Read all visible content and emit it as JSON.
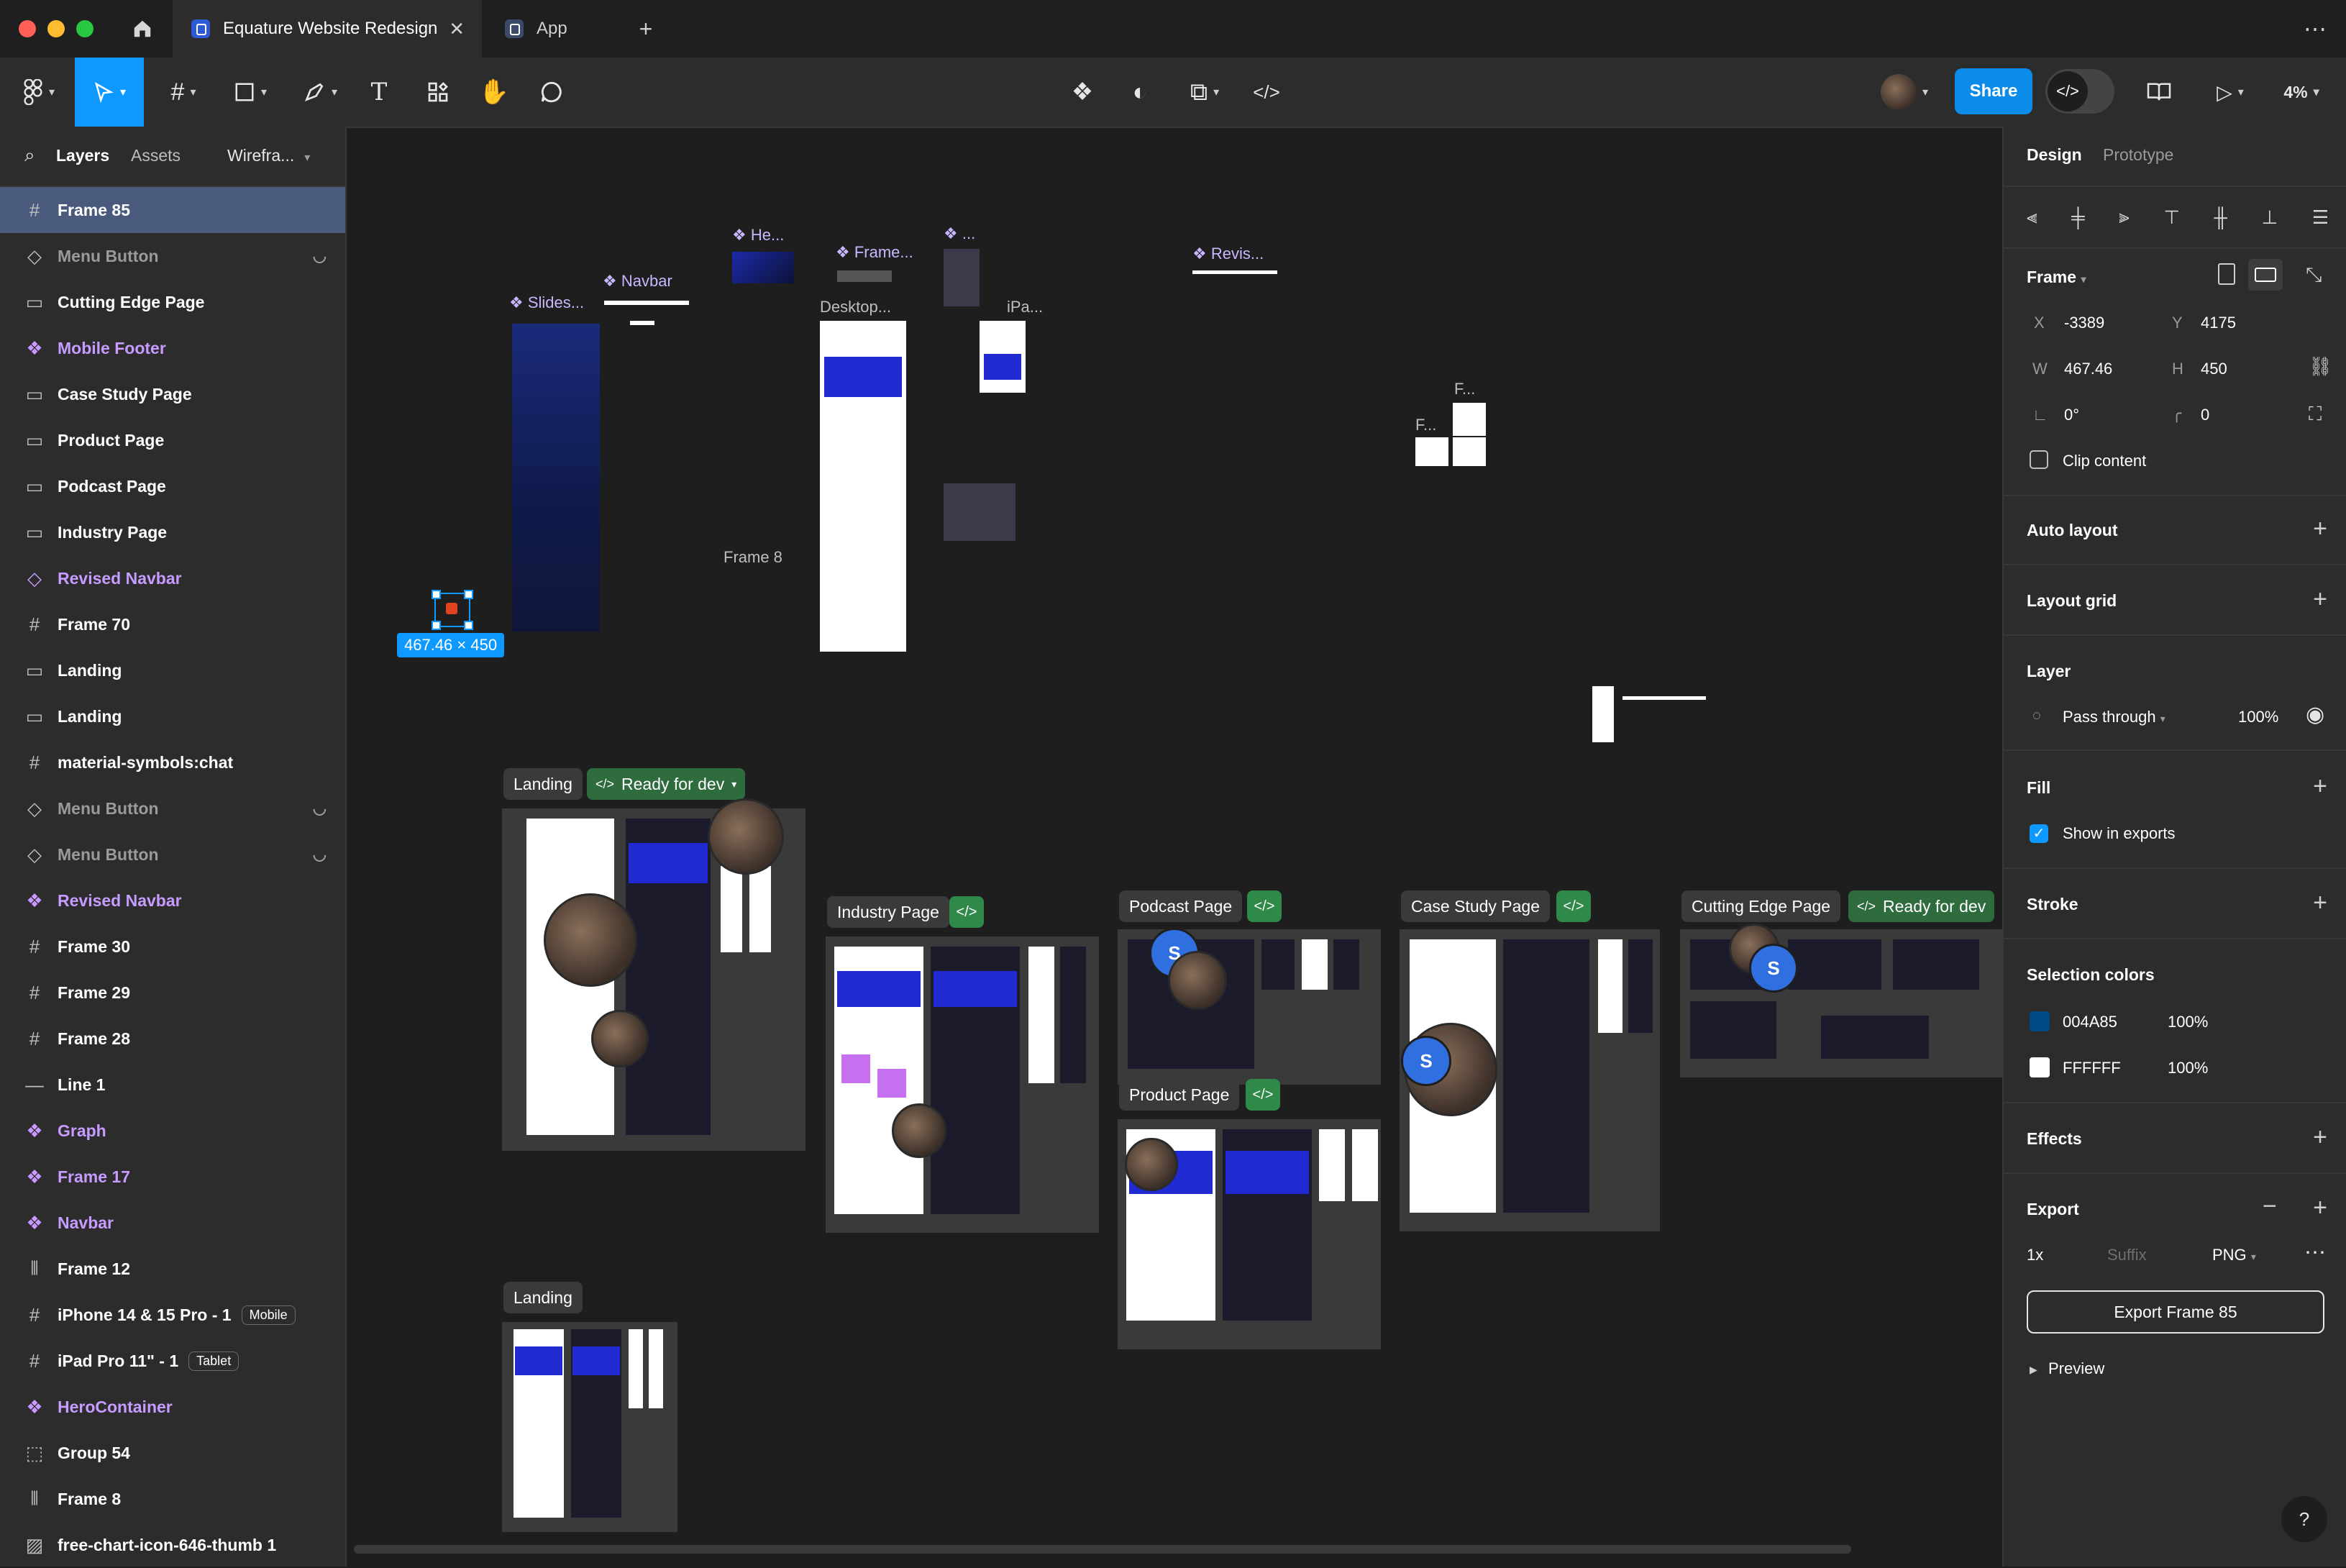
{
  "titlebar": {
    "tabs": [
      {
        "label": "Equature Website Redesign",
        "active": true
      },
      {
        "label": "App",
        "active": false
      }
    ],
    "new_tab_icon": "plus-icon",
    "more_icon": "more-icon"
  },
  "toolbar": {
    "share_label": "Share",
    "zoom_label": "4%"
  },
  "left_panel": {
    "tabs": [
      "Layers",
      "Assets"
    ],
    "page_selector": "Wirefra...",
    "layers": [
      {
        "name": "Frame 85",
        "icon": "frame-icon",
        "style": "selected"
      },
      {
        "name": "Menu Button",
        "icon": "instance-icon",
        "style": "dim",
        "hidden": true
      },
      {
        "name": "Cutting Edge Page",
        "icon": "section-icon",
        "style": "normal"
      },
      {
        "name": "Mobile Footer",
        "icon": "component-icon",
        "style": "purple"
      },
      {
        "name": "Case Study Page",
        "icon": "section-icon",
        "style": "normal"
      },
      {
        "name": "Product Page",
        "icon": "section-icon",
        "style": "normal"
      },
      {
        "name": "Podcast Page",
        "icon": "section-icon",
        "style": "normal"
      },
      {
        "name": "Industry Page",
        "icon": "section-icon",
        "style": "normal"
      },
      {
        "name": "Revised Navbar",
        "icon": "instance-icon",
        "style": "purple"
      },
      {
        "name": "Frame 70",
        "icon": "frame-icon",
        "style": "normal"
      },
      {
        "name": "Landing",
        "icon": "section-icon",
        "style": "normal"
      },
      {
        "name": "Landing",
        "icon": "section-icon",
        "style": "normal"
      },
      {
        "name": "material-symbols:chat",
        "icon": "frame-icon",
        "style": "normal"
      },
      {
        "name": "Menu Button",
        "icon": "instance-icon",
        "style": "dim",
        "hidden": true
      },
      {
        "name": "Menu Button",
        "icon": "instance-icon",
        "style": "dim",
        "hidden": true
      },
      {
        "name": "Revised Navbar",
        "icon": "component-icon",
        "style": "purple"
      },
      {
        "name": "Frame 30",
        "icon": "frame-icon",
        "style": "normal"
      },
      {
        "name": "Frame 29",
        "icon": "frame-icon",
        "style": "normal"
      },
      {
        "name": "Frame 28",
        "icon": "frame-icon",
        "style": "normal"
      },
      {
        "name": "Line 1",
        "icon": "line-icon",
        "style": "normal"
      },
      {
        "name": "Graph",
        "icon": "component-icon",
        "style": "purple"
      },
      {
        "name": "Frame 17",
        "icon": "component-icon",
        "style": "purple"
      },
      {
        "name": "Navbar",
        "icon": "component-icon",
        "style": "purple"
      },
      {
        "name": "Frame 12",
        "icon": "columns-icon",
        "style": "normal"
      },
      {
        "name": "iPhone 14 & 15 Pro - 1",
        "icon": "frame-icon",
        "style": "normal",
        "badge": "Mobile"
      },
      {
        "name": "iPad Pro 11\" - 1",
        "icon": "frame-icon",
        "style": "normal",
        "badge": "Tablet"
      },
      {
        "name": "HeroContainer",
        "icon": "component-icon",
        "style": "purple"
      },
      {
        "name": "Group 54",
        "icon": "group-icon",
        "style": "normal"
      },
      {
        "name": "Frame 8",
        "icon": "columns-icon",
        "style": "normal"
      },
      {
        "name": "free-chart-icon-646-thumb 1",
        "icon": "image-icon",
        "style": "normal"
      }
    ]
  },
  "canvas": {
    "selection_size": "467.46 × 450",
    "labels": {
      "slides": "Slides...",
      "navbar": "Navbar",
      "hero": "He...",
      "frame_comp": "Frame...",
      "dots": "...",
      "revis": "Revis...",
      "desktop": "Desktop...",
      "ipad": "iPa...",
      "frame8": "Frame 8",
      "f1": "F...",
      "f2": "F..."
    },
    "sections": {
      "landing": "Landing",
      "landing_ready": "Ready for dev",
      "industry": "Industry Page",
      "podcast": "Podcast Page",
      "case_study": "Case Study Page",
      "cutting_edge": "Cutting Edge Page",
      "cutting_ready": "Ready for dev",
      "product": "Product Page",
      "landing2": "Landing"
    },
    "code_icon": "</>",
    "user_initial": "S"
  },
  "right_panel": {
    "tabs": [
      "Design",
      "Prototype"
    ],
    "frame_label": "Frame",
    "x_label": "X",
    "x_value": "-3389",
    "y_label": "Y",
    "y_value": "4175",
    "w_label": "W",
    "w_value": "467.46",
    "h_label": "H",
    "h_value": "450",
    "rotation": "0°",
    "radius": "0",
    "clip_content": "Clip content",
    "auto_layout": "Auto layout",
    "layout_grid": "Layout grid",
    "layer": "Layer",
    "blend_mode": "Pass through",
    "layer_opacity": "100%",
    "fill": "Fill",
    "show_in_exports": "Show in exports",
    "stroke": "Stroke",
    "selection_colors": "Selection colors",
    "colors": [
      {
        "hex": "004A85",
        "opacity": "100%",
        "swatch": "#004A85"
      },
      {
        "hex": "FFFFFF",
        "opacity": "100%",
        "swatch": "#FFFFFF"
      }
    ],
    "effects": "Effects",
    "export": "Export",
    "export_scale": "1x",
    "export_suffix_placeholder": "Suffix",
    "export_format": "PNG",
    "export_button": "Export Frame 85",
    "preview": "Preview",
    "help": "?"
  },
  "colors": {
    "accent": "#0d99ff",
    "share": "#0c8ce9",
    "component": "#c79bff",
    "selection": "#4a5a7c",
    "ready": "#2f8a4a"
  }
}
